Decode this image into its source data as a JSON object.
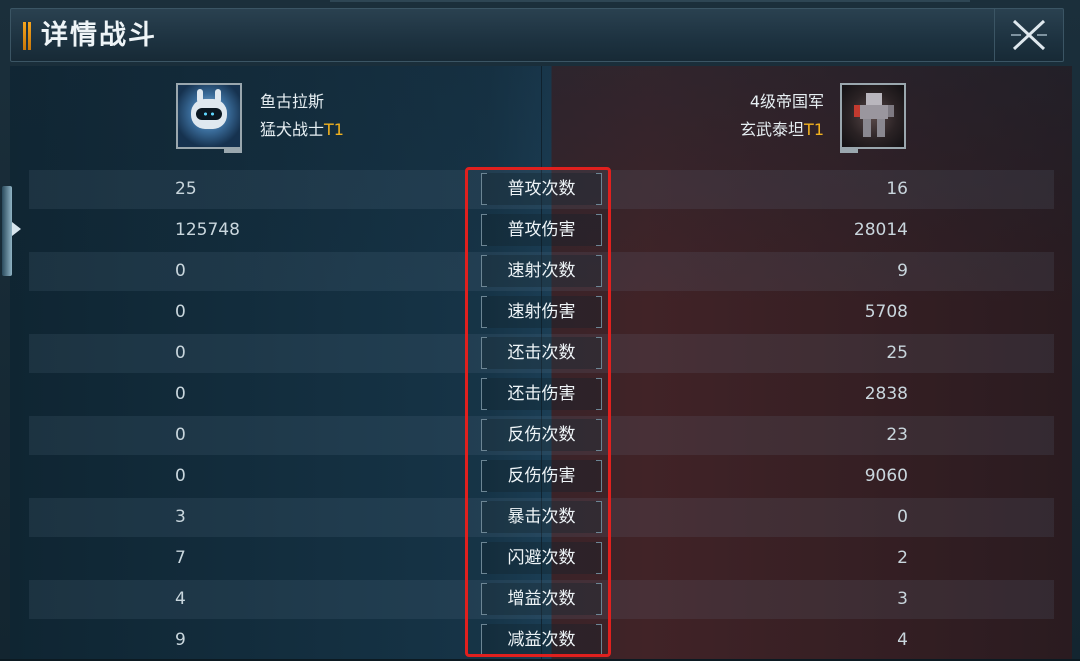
{
  "window": {
    "title": "详情战斗",
    "close_icon": "close-icon"
  },
  "attacker": {
    "name": "鱼古拉斯",
    "class": "猛犬战士",
    "tier": "T1"
  },
  "defender": {
    "name": "4级帝国军",
    "class": "玄武泰坦",
    "tier": "T1"
  },
  "stats": [
    {
      "label": "普攻次数",
      "left": "25",
      "right": "16"
    },
    {
      "label": "普攻伤害",
      "left": "125748",
      "right": "28014"
    },
    {
      "label": "速射次数",
      "left": "0",
      "right": "9"
    },
    {
      "label": "速射伤害",
      "left": "0",
      "right": "5708"
    },
    {
      "label": "还击次数",
      "left": "0",
      "right": "25"
    },
    {
      "label": "还击伤害",
      "left": "0",
      "right": "2838"
    },
    {
      "label": "反伤次数",
      "left": "0",
      "right": "23"
    },
    {
      "label": "反伤伤害",
      "left": "0",
      "right": "9060"
    },
    {
      "label": "暴击次数",
      "left": "3",
      "right": "0"
    },
    {
      "label": "闪避次数",
      "left": "7",
      "right": "2"
    },
    {
      "label": "增益次数",
      "left": "4",
      "right": "3"
    },
    {
      "label": "减益次数",
      "left": "9",
      "right": "4"
    }
  ],
  "colors": {
    "accent": "#f5a51e",
    "tier": "#f2b21f",
    "highlight": "#e0201e"
  }
}
